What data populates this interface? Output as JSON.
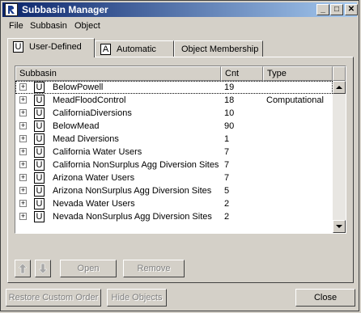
{
  "window": {
    "title": "Subbasin Manager"
  },
  "menu": [
    "File",
    "Subbasin",
    "Object"
  ],
  "tabs": [
    {
      "glyph": "U",
      "label": "User-Defined",
      "active": true
    },
    {
      "glyph": "A",
      "label": "Automatic",
      "active": false
    },
    {
      "label": "Object Membership",
      "active": false
    }
  ],
  "table": {
    "columns": [
      "Subbasin",
      "Cnt",
      "Type"
    ],
    "rows": [
      {
        "name": "BelowPowell",
        "cnt": "19",
        "type": ""
      },
      {
        "name": "MeadFloodControl",
        "cnt": "18",
        "type": "Computational"
      },
      {
        "name": "CaliforniaDiversions",
        "cnt": "10",
        "type": ""
      },
      {
        "name": "BelowMead",
        "cnt": "90",
        "type": ""
      },
      {
        "name": "Mead Diversions",
        "cnt": "1",
        "type": ""
      },
      {
        "name": "California Water Users",
        "cnt": "7",
        "type": ""
      },
      {
        "name": "California NonSurplus Agg Diversion Sites",
        "cnt": "7",
        "type": ""
      },
      {
        "name": "Arizona Water Users",
        "cnt": "7",
        "type": ""
      },
      {
        "name": "Arizona NonSurplus Agg Diversion Sites",
        "cnt": "5",
        "type": ""
      },
      {
        "name": "Nevada Water Users",
        "cnt": "2",
        "type": ""
      },
      {
        "name": "Nevada NonSurplus Agg Diversion Sites",
        "cnt": "2",
        "type": ""
      }
    ],
    "row_icon": "U",
    "expander": "+"
  },
  "buttons": {
    "open": "Open",
    "remove": "Remove",
    "restore": "Restore Custom Order",
    "hide": "Hide Objects",
    "close": "Close"
  }
}
